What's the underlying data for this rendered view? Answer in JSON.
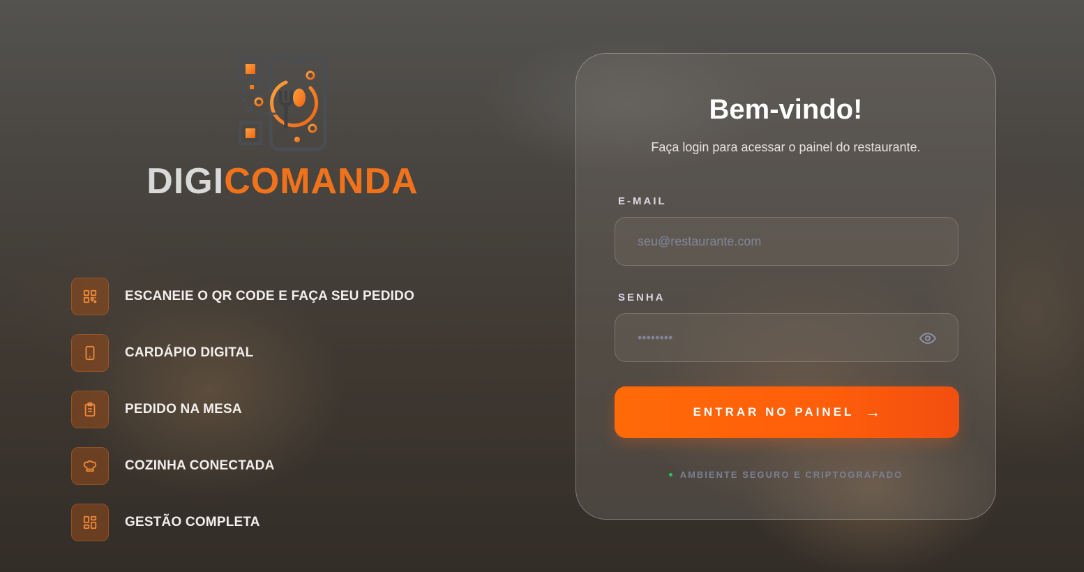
{
  "brand": {
    "logo": "qr-phone-fork-spoon-logo",
    "name_part1": "DigiComanda_part1",
    "name_first": "DIGI",
    "name_second": "COMANDA",
    "colors": {
      "gray": "#d9d9d9",
      "accent": "#f0731c"
    }
  },
  "features": [
    {
      "icon": "qr-code-icon",
      "label": "ESCANEIE O QR CODE E FAÇA SEU PEDIDO"
    },
    {
      "icon": "smartphone-icon",
      "label": "CARDÁPIO DIGITAL"
    },
    {
      "icon": "clipboard-icon",
      "label": "PEDIDO NA MESA"
    },
    {
      "icon": "chef-hat-icon",
      "label": "COZINHA CONECTADA"
    },
    {
      "icon": "dashboard-grid-icon",
      "label": "GESTÃO COMPLETA"
    }
  ],
  "login": {
    "title": "Bem-vindo!",
    "subtitle": "Faça login para acessar o painel do restaurante.",
    "email_label": "E-MAIL",
    "email_placeholder": "seu@restaurante.com",
    "password_label": "SENHA",
    "password_placeholder": "••••••••",
    "submit_label": "ENTRAR NO PAINEL",
    "submit_arrow": "→",
    "secure_text": "AMBIENTE SEGURO E CRIPTOGRAFADO",
    "accent_color": "#ff6a08",
    "secure_dot_color": "#22c55e"
  }
}
